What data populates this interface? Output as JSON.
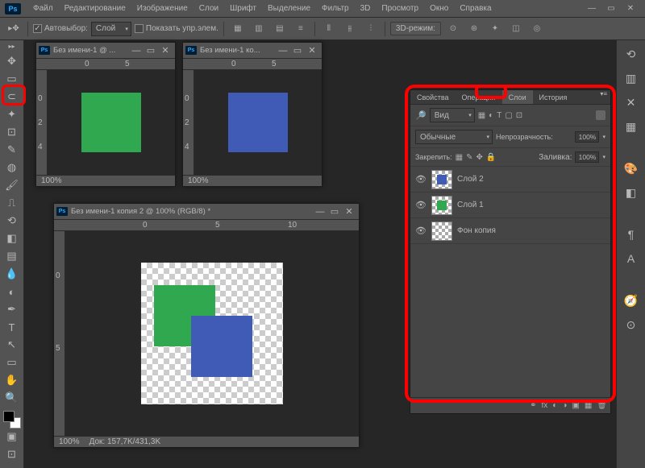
{
  "menubar": {
    "items": [
      "Файл",
      "Редактирование",
      "Изображение",
      "Слои",
      "Шрифт",
      "Выделение",
      "Фильтр",
      "3D",
      "Просмотр",
      "Окно",
      "Справка"
    ]
  },
  "options": {
    "autoselect_label": "Автовыбор:",
    "autoselect_dd": "Слой",
    "show_controls": "Показать упр.элем.",
    "mode3d": "3D-режим:"
  },
  "docs": {
    "d1": {
      "title": "Без имени-1 @ ...",
      "zoom": "100%"
    },
    "d2": {
      "title": "Без имени-1 ко...",
      "zoom": "100%"
    },
    "d3": {
      "title": "Без имени-1 копия 2 @ 100% (RGB/8) *",
      "zoom": "100%",
      "status": "Док: 157,7K/431,3K"
    }
  },
  "ruler": {
    "n0": "0",
    "n5": "5",
    "n10": "10",
    "n2": "2",
    "n4": "4"
  },
  "panel": {
    "tabs": {
      "props": "Свойства",
      "actions": "Операции",
      "layers": "Слои",
      "history": "История"
    },
    "filter_label": "Вид",
    "filter_arrow": "⇄",
    "blend": "Обычные",
    "opacity_label": "Непрозрачность:",
    "opacity": "100%",
    "lock_label": "Закрепить:",
    "fill_label": "Заливка:",
    "fill": "100%",
    "layers": [
      {
        "name": "Слой 2",
        "color": "#3f5bb5"
      },
      {
        "name": "Слой 1",
        "color": "#2fa84f"
      },
      {
        "name": "Фон копия",
        "color": null
      }
    ]
  },
  "icons": {
    "move": "✥",
    "marquee": "▭",
    "lasso": "⊂",
    "wand": "✦",
    "crop": "⊡",
    "eyedrop": "✎",
    "heal": "◍",
    "brush": "🖌",
    "stamp": "⎍",
    "history": "⟲",
    "eraser": "◧",
    "gradient": "▤",
    "blur": "💧",
    "dodge": "◐",
    "pen": "✒",
    "type": "T",
    "path": "↖",
    "shape": "▭",
    "hand": "✋",
    "zoom": "🔍",
    "link": "⚭",
    "fx": "fx",
    "mask": "◐",
    "adjust": "◑",
    "group": "▣",
    "new": "▦",
    "trash": "🗑",
    "min": "—",
    "max": "▭",
    "close": "✕"
  }
}
